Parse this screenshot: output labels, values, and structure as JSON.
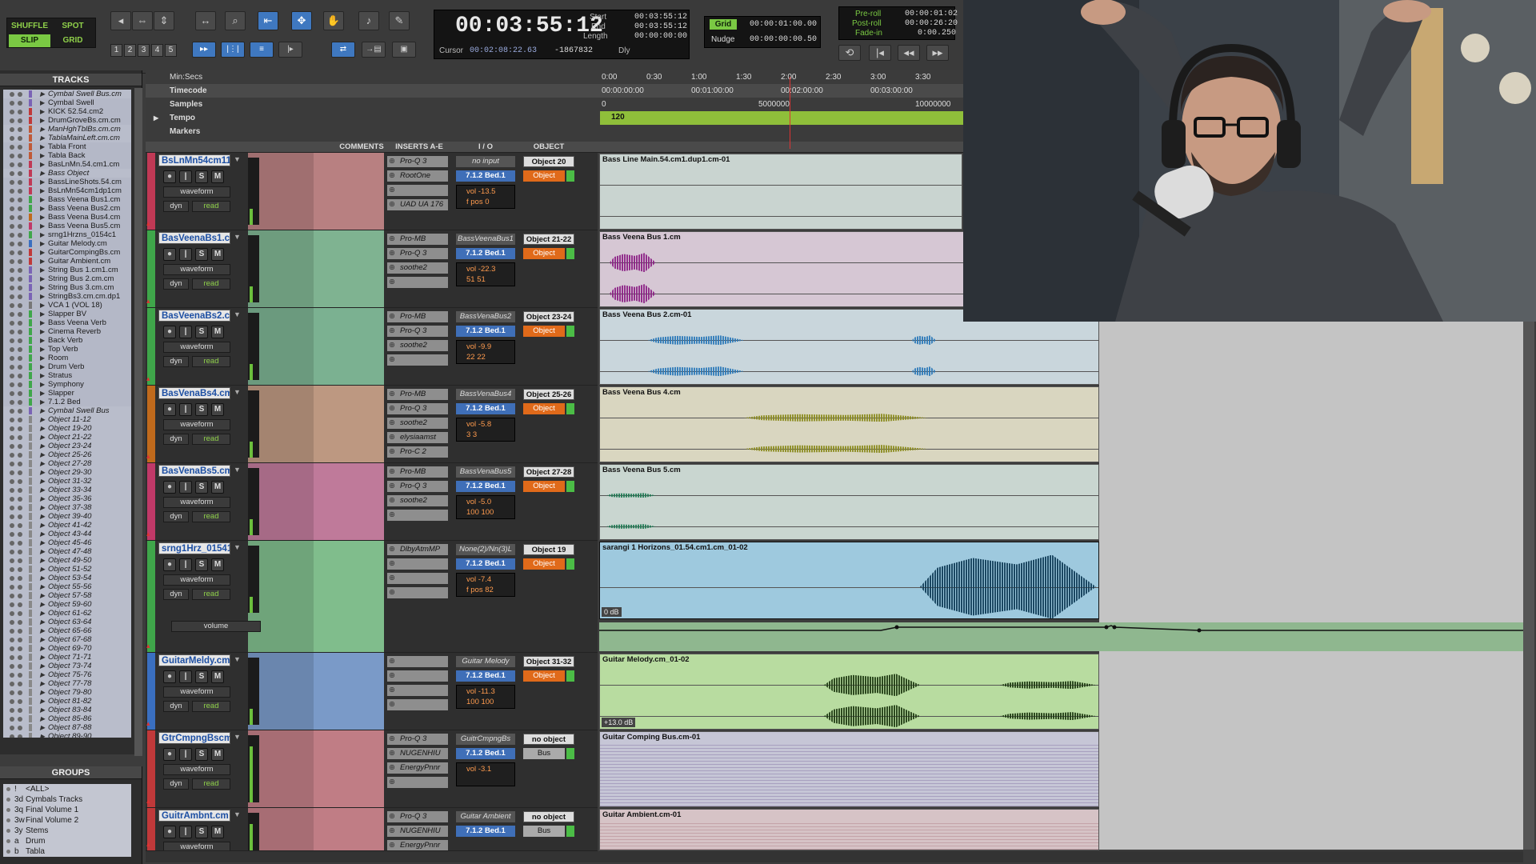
{
  "toolbar": {
    "modes": {
      "shuffle": "SHUFFLE",
      "spot": "SPOT",
      "slip": "SLIP",
      "grid": "GRID"
    },
    "numbers": [
      "1",
      "2",
      "3",
      "4",
      "5"
    ],
    "main_counter": "00:03:55:12",
    "start_label": "Start",
    "start_value": "00:03:55:12",
    "end_label": "End",
    "end_value": "00:03:55:12",
    "length_label": "Length",
    "length_value": "00:00:00:00",
    "cursor_label": "Cursor",
    "cursor_value": "00:02:08:22.63",
    "cursor_extra": "-1867832",
    "dly_label": "Dly",
    "grid_label": "Grid",
    "grid_value": "00:00:01:00.00",
    "nudge_label": "Nudge",
    "nudge_value": "00:00:00:00.50",
    "preroll_label": "Pre-roll",
    "preroll_value": "00:00:01:02",
    "postroll_label": "Post-roll",
    "postroll_value": "00:00:26:20",
    "fadein_label": "Fade-in",
    "fadein_value": "0:00.250"
  },
  "tracks_panel": {
    "title": "TRACKS",
    "items": [
      {
        "name": "Cymbal Swell Bus.cm",
        "italic": true,
        "color": "#7a63b5"
      },
      {
        "name": "Cymbal Swell",
        "italic": false,
        "color": "#7a63b5"
      },
      {
        "name": "KICK 52.54.cm2",
        "italic": false,
        "color": "#c0393a"
      },
      {
        "name": "DrumGroveBs.cm.cm",
        "italic": false,
        "color": "#c0393a"
      },
      {
        "name": "ManHghTblBs.cm.cm",
        "italic": true,
        "color": "#c05a39"
      },
      {
        "name": "TablaMainLeft.cm.cm",
        "italic": true,
        "color": "#c05a39"
      },
      {
        "name": "Tabla Front",
        "italic": false,
        "color": "#c05a39"
      },
      {
        "name": "Tabla Back",
        "italic": false,
        "color": "#c05a39"
      },
      {
        "name": "BasLnMn.54.cm1.cm",
        "italic": false,
        "color": "#c03955"
      },
      {
        "name": "Bass Object",
        "italic": true,
        "color": "#c03955"
      },
      {
        "name": "BassLineShots.54.cm",
        "italic": false,
        "color": "#c03955"
      },
      {
        "name": "BsLnMn54cm1dp1cm",
        "italic": false,
        "color": "#c03955"
      },
      {
        "name": "Bass Veena Bus1.cm",
        "italic": false,
        "color": "#3fa64a"
      },
      {
        "name": "Bass Veena Bus2.cm",
        "italic": false,
        "color": "#3fa64a"
      },
      {
        "name": "Bass Veena Bus4.cm",
        "italic": false,
        "color": "#c06a1c"
      },
      {
        "name": "Bass Veena Bus5.cm",
        "italic": false,
        "color": "#c03968"
      },
      {
        "name": "srng1Hrzns_0154c1",
        "italic": false,
        "color": "#3fa64a"
      },
      {
        "name": "Guitar Melody.cm",
        "italic": false,
        "color": "#3a6fc0"
      },
      {
        "name": "GuitarCompingBs.cm",
        "italic": false,
        "color": "#c0393a"
      },
      {
        "name": "Guitar Ambient.cm",
        "italic": false,
        "color": "#c0393a"
      },
      {
        "name": "String Bus 1.cm1.cm",
        "italic": false,
        "color": "#7a63b5"
      },
      {
        "name": "String Bus 2.cm.cm",
        "italic": false,
        "color": "#7a63b5"
      },
      {
        "name": "String Bus 3.cm.cm",
        "italic": false,
        "color": "#7a63b5"
      },
      {
        "name": "StringBs3.cm.cm.dp1",
        "italic": false,
        "color": "#7a63b5"
      },
      {
        "name": "VCA 1 (VOL 18)",
        "italic": false,
        "color": "#777777"
      },
      {
        "name": "Slapper BV",
        "italic": false,
        "color": "#3fa64a"
      },
      {
        "name": "Bass Veena Verb",
        "italic": false,
        "color": "#3fa64a"
      },
      {
        "name": "Cinema Reverb",
        "italic": false,
        "color": "#3fa64a"
      },
      {
        "name": "Back Verb",
        "italic": false,
        "color": "#3fa64a"
      },
      {
        "name": "Top Verb",
        "italic": false,
        "color": "#3fa64a"
      },
      {
        "name": "Room",
        "italic": false,
        "color": "#3fa64a"
      },
      {
        "name": "Drum Verb",
        "italic": false,
        "color": "#3fa64a"
      },
      {
        "name": "Stratus",
        "italic": false,
        "color": "#3fa64a"
      },
      {
        "name": "Symphony",
        "italic": false,
        "color": "#3fa64a"
      },
      {
        "name": "Slapper",
        "italic": false,
        "color": "#3fa64a"
      },
      {
        "name": "7.1.2 Bed",
        "italic": false,
        "color": "#3fa64a"
      },
      {
        "name": "Cymbal Swell Bus",
        "italic": true,
        "color": "#7a63b5"
      },
      {
        "name": "Object 11-12",
        "italic": true,
        "color": "#888888"
      },
      {
        "name": "Object 19-20",
        "italic": true,
        "color": "#888888"
      },
      {
        "name": "Object 21-22",
        "italic": true,
        "color": "#888888"
      },
      {
        "name": "Object 23-24",
        "italic": true,
        "color": "#888888"
      },
      {
        "name": "Object 25-26",
        "italic": true,
        "color": "#888888"
      },
      {
        "name": "Object 27-28",
        "italic": true,
        "color": "#888888"
      },
      {
        "name": "Object 29-30",
        "italic": true,
        "color": "#888888"
      },
      {
        "name": "Object 31-32",
        "italic": true,
        "color": "#888888"
      },
      {
        "name": "Object 33-34",
        "italic": true,
        "color": "#888888"
      },
      {
        "name": "Object 35-36",
        "italic": true,
        "color": "#888888"
      },
      {
        "name": "Object 37-38",
        "italic": true,
        "color": "#888888"
      },
      {
        "name": "Object 39-40",
        "italic": true,
        "color": "#888888"
      },
      {
        "name": "Object 41-42",
        "italic": true,
        "color": "#888888"
      },
      {
        "name": "Object 43-44",
        "italic": true,
        "color": "#888888"
      },
      {
        "name": "Object 45-46",
        "italic": true,
        "color": "#888888"
      },
      {
        "name": "Object 47-48",
        "italic": true,
        "color": "#888888"
      },
      {
        "name": "Object 49-50",
        "italic": true,
        "color": "#888888"
      },
      {
        "name": "Object 51-52",
        "italic": true,
        "color": "#888888"
      },
      {
        "name": "Object 53-54",
        "italic": true,
        "color": "#888888"
      },
      {
        "name": "Object 55-56",
        "italic": true,
        "color": "#888888"
      },
      {
        "name": "Object 57-58",
        "italic": true,
        "color": "#888888"
      },
      {
        "name": "Object 59-60",
        "italic": true,
        "color": "#888888"
      },
      {
        "name": "Object 61-62",
        "italic": true,
        "color": "#888888"
      },
      {
        "name": "Object 63-64",
        "italic": true,
        "color": "#888888"
      },
      {
        "name": "Object 65-66",
        "italic": true,
        "color": "#888888"
      },
      {
        "name": "Object 67-68",
        "italic": true,
        "color": "#888888"
      },
      {
        "name": "Object 69-70",
        "italic": true,
        "color": "#888888"
      },
      {
        "name": "Object 71-71",
        "italic": true,
        "color": "#888888"
      },
      {
        "name": "Object 73-74",
        "italic": true,
        "color": "#888888"
      },
      {
        "name": "Object 75-76",
        "italic": true,
        "color": "#888888"
      },
      {
        "name": "Object 77-78",
        "italic": true,
        "color": "#888888"
      },
      {
        "name": "Object 79-80",
        "italic": true,
        "color": "#888888"
      },
      {
        "name": "Object 81-82",
        "italic": true,
        "color": "#888888"
      },
      {
        "name": "Object 83-84",
        "italic": true,
        "color": "#888888"
      },
      {
        "name": "Object 85-86",
        "italic": true,
        "color": "#888888"
      },
      {
        "name": "Object 87-88",
        "italic": true,
        "color": "#888888"
      },
      {
        "name": "Object 89-90",
        "italic": true,
        "color": "#888888"
      },
      {
        "name": "Object 91-92",
        "italic": true,
        "color": "#888888"
      },
      {
        "name": "Object 93-94",
        "italic": true,
        "color": "#888888"
      }
    ]
  },
  "groups_panel": {
    "title": "GROUPS",
    "items": [
      {
        "id": "!",
        "name": "<ALL>"
      },
      {
        "id": "3d",
        "name": "Cymbals Tracks"
      },
      {
        "id": "3q",
        "name": "Final Volume 1"
      },
      {
        "id": "3w",
        "name": "Final Volume 2"
      },
      {
        "id": "3y",
        "name": "Stems"
      },
      {
        "id": "a",
        "name": "Drum"
      },
      {
        "id": "b",
        "name": "Tabla"
      }
    ]
  },
  "rulers": {
    "minsecs_label": "Min:Secs",
    "timecode_label": "Timecode",
    "samples_label": "Samples",
    "tempo_label": "Tempo",
    "markers_label": "Markers",
    "minsec_ticks": [
      "0:00",
      "0:30",
      "1:00",
      "1:30",
      "2:00",
      "2:30",
      "3:00",
      "3:30"
    ],
    "timecode_ticks": [
      "00:00:00:00",
      "00:01:00:00",
      "00:02:00:00",
      "00:03:00:00"
    ],
    "sample_ticks": [
      "0",
      "5000000",
      "10000000"
    ],
    "tempo_value": "120"
  },
  "edit_columns": {
    "comments": "COMMENTS",
    "inserts": "INSERTS A-E",
    "io": "I / O",
    "object": "OBJECT"
  },
  "common": {
    "waveform": "waveform",
    "dyn": "dyn",
    "read": "read",
    "s": "S",
    "m": "M",
    "volume": "volume"
  },
  "tracks": [
    {
      "name": "BsLnMn54cm11",
      "color": "#c03955",
      "bg": "#a06f70",
      "inserts": [
        "Pro-Q 3",
        "RootOne",
        "",
        "UAD UA 176"
      ],
      "io_in": "no input",
      "io_out": "7.1.2 Bed.1",
      "vol": "vol -13.5",
      "pan": "f pos  0",
      "obj_label": "Object 20",
      "obj_btn": "Object",
      "clip": "Bass Line Main.54.cm1.dup1.cm-01",
      "clip_bg": "#c9d4d0"
    },
    {
      "name": "BasVeenaBs1.cm",
      "color": "#3fa64a",
      "bg": "#6e9c7e",
      "inserts": [
        "Pro-MB",
        "Pro-Q 3",
        "soothe2",
        ""
      ],
      "io_in": "BassVeenaBus1",
      "io_out": "7.1.2 Bed.1",
      "vol": "vol -22.3",
      "pan": "51    51",
      "obj_label": "Object 21-22",
      "obj_btn": "Object",
      "clip": "Bass Veena Bus 1.cm",
      "clip_bg": "#d6c7d4"
    },
    {
      "name": "BasVeenaBs2.cm",
      "color": "#3fa64a",
      "bg": "#6b9a7e",
      "inserts": [
        "Pro-MB",
        "Pro-Q 3",
        "soothe2",
        ""
      ],
      "io_in": "BassVenaBus2",
      "io_out": "7.1.2 Bed.1",
      "vol": "vol -9.9",
      "pan": "22    22",
      "obj_label": "Object 23-24",
      "obj_btn": "Object",
      "clip": "Bass Veena Bus 2.cm-01",
      "clip_bg": "#c9d6dc"
    },
    {
      "name": "BasVenaBs4.cm",
      "color": "#c06a1c",
      "bg": "#a48470",
      "inserts": [
        "Pro-MB",
        "Pro-Q 3",
        "soothe2",
        "elysiaamst",
        "Pro-C 2"
      ],
      "io_in": "BassVenaBus4",
      "io_out": "7.1.2 Bed.1",
      "vol": "vol -5.8",
      "pan": "3    3",
      "obj_label": "Object 25-26",
      "obj_btn": "Object",
      "clip": "Bass Veena Bus 4.cm",
      "clip_bg": "#d9d6c0"
    },
    {
      "name": "BasVenaBs5.cm",
      "color": "#c03968",
      "bg": "#a66a86",
      "inserts": [
        "Pro-MB",
        "Pro-Q 3",
        "soothe2",
        ""
      ],
      "io_in": "BassVenaBus5",
      "io_out": "7.1.2 Bed.1",
      "vol": "vol -5.0",
      "pan": "100   100",
      "obj_label": "Object 27-28",
      "obj_btn": "Object",
      "clip": "Bass Veena Bus 5.cm",
      "clip_bg": "#c9d6d0"
    },
    {
      "name": "srng1Hrz_01541",
      "color": "#3fa64a",
      "bg": "#6fa47a",
      "inserts": [
        "DlbyAtmMP",
        "",
        "",
        ""
      ],
      "io_in": "None(2)/Nn(3)L",
      "io_out": "7.1.2 Bed.1",
      "vol": "vol -7.4",
      "pan": "f pos  82",
      "obj_label": "Object 19",
      "obj_btn": "Object",
      "clip": "sarangi 1 Horizons_01.54.cm1.cm_01-02",
      "clip_bg": "#9ec9de",
      "gain": "0 dB"
    },
    {
      "name": "GuitarMeldy.cm",
      "color": "#3a6fc0",
      "bg": "#6a86ae",
      "inserts": [
        "",
        "",
        "",
        ""
      ],
      "io_in": "Guitar Melody",
      "io_out": "7.1.2 Bed.1",
      "vol": "vol -11.3",
      "pan": "100   100",
      "obj_label": "Object 31-32",
      "obj_btn": "Object",
      "clip": "Guitar Melody.cm_01-02",
      "clip_bg": "#b8dca0",
      "gain": "+13.0 dB"
    },
    {
      "name": "GtrCmpngBscm",
      "color": "#c0393a",
      "bg": "#a76d74",
      "inserts": [
        "Pro-Q 3",
        "NUGENHIU",
        "EnergyPnnr",
        ""
      ],
      "io_in": "GuitrCmpngBs",
      "io_out": "7.1.2 Bed.1",
      "vol": "vol -3.1",
      "pan": "",
      "obj_label": "no object",
      "obj_btn": "Bus",
      "clip": "Guitar Comping Bus.cm-01",
      "clip_bg": "#c6c6d6"
    },
    {
      "name": "GuitrAmbnt.cm",
      "color": "#c0393a",
      "bg": "#a76d74",
      "inserts": [
        "Pro-Q 3",
        "NUGENHIU",
        "EnergyPnnr",
        ""
      ],
      "io_in": "Guitar Ambient",
      "io_out": "7.1.2 Bed.1",
      "vol": "",
      "pan": "",
      "obj_label": "no object",
      "obj_btn": "Bus",
      "clip": "Guitar Ambient.cm-01",
      "clip_bg": "#d6c3c6"
    }
  ]
}
